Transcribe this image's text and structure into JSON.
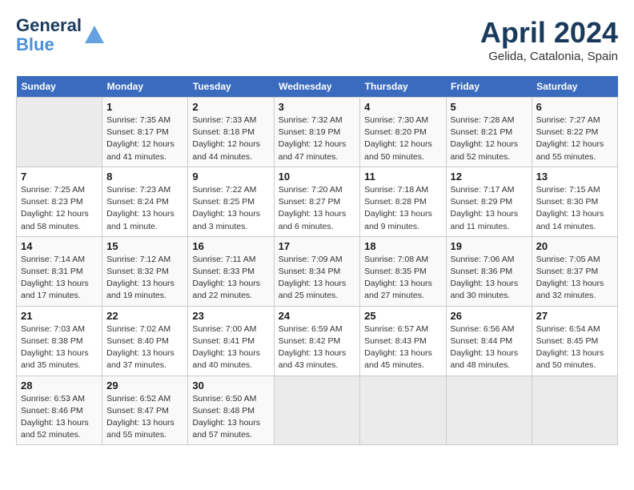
{
  "header": {
    "logo_line1": "General",
    "logo_line2": "Blue",
    "month_title": "April 2024",
    "subtitle": "Gelida, Catalonia, Spain"
  },
  "days_of_week": [
    "Sunday",
    "Monday",
    "Tuesday",
    "Wednesday",
    "Thursday",
    "Friday",
    "Saturday"
  ],
  "weeks": [
    [
      {
        "day": "",
        "info": ""
      },
      {
        "day": "1",
        "info": "Sunrise: 7:35 AM\nSunset: 8:17 PM\nDaylight: 12 hours\nand 41 minutes."
      },
      {
        "day": "2",
        "info": "Sunrise: 7:33 AM\nSunset: 8:18 PM\nDaylight: 12 hours\nand 44 minutes."
      },
      {
        "day": "3",
        "info": "Sunrise: 7:32 AM\nSunset: 8:19 PM\nDaylight: 12 hours\nand 47 minutes."
      },
      {
        "day": "4",
        "info": "Sunrise: 7:30 AM\nSunset: 8:20 PM\nDaylight: 12 hours\nand 50 minutes."
      },
      {
        "day": "5",
        "info": "Sunrise: 7:28 AM\nSunset: 8:21 PM\nDaylight: 12 hours\nand 52 minutes."
      },
      {
        "day": "6",
        "info": "Sunrise: 7:27 AM\nSunset: 8:22 PM\nDaylight: 12 hours\nand 55 minutes."
      }
    ],
    [
      {
        "day": "7",
        "info": "Sunrise: 7:25 AM\nSunset: 8:23 PM\nDaylight: 12 hours\nand 58 minutes."
      },
      {
        "day": "8",
        "info": "Sunrise: 7:23 AM\nSunset: 8:24 PM\nDaylight: 13 hours\nand 1 minute."
      },
      {
        "day": "9",
        "info": "Sunrise: 7:22 AM\nSunset: 8:25 PM\nDaylight: 13 hours\nand 3 minutes."
      },
      {
        "day": "10",
        "info": "Sunrise: 7:20 AM\nSunset: 8:27 PM\nDaylight: 13 hours\nand 6 minutes."
      },
      {
        "day": "11",
        "info": "Sunrise: 7:18 AM\nSunset: 8:28 PM\nDaylight: 13 hours\nand 9 minutes."
      },
      {
        "day": "12",
        "info": "Sunrise: 7:17 AM\nSunset: 8:29 PM\nDaylight: 13 hours\nand 11 minutes."
      },
      {
        "day": "13",
        "info": "Sunrise: 7:15 AM\nSunset: 8:30 PM\nDaylight: 13 hours\nand 14 minutes."
      }
    ],
    [
      {
        "day": "14",
        "info": "Sunrise: 7:14 AM\nSunset: 8:31 PM\nDaylight: 13 hours\nand 17 minutes."
      },
      {
        "day": "15",
        "info": "Sunrise: 7:12 AM\nSunset: 8:32 PM\nDaylight: 13 hours\nand 19 minutes."
      },
      {
        "day": "16",
        "info": "Sunrise: 7:11 AM\nSunset: 8:33 PM\nDaylight: 13 hours\nand 22 minutes."
      },
      {
        "day": "17",
        "info": "Sunrise: 7:09 AM\nSunset: 8:34 PM\nDaylight: 13 hours\nand 25 minutes."
      },
      {
        "day": "18",
        "info": "Sunrise: 7:08 AM\nSunset: 8:35 PM\nDaylight: 13 hours\nand 27 minutes."
      },
      {
        "day": "19",
        "info": "Sunrise: 7:06 AM\nSunset: 8:36 PM\nDaylight: 13 hours\nand 30 minutes."
      },
      {
        "day": "20",
        "info": "Sunrise: 7:05 AM\nSunset: 8:37 PM\nDaylight: 13 hours\nand 32 minutes."
      }
    ],
    [
      {
        "day": "21",
        "info": "Sunrise: 7:03 AM\nSunset: 8:38 PM\nDaylight: 13 hours\nand 35 minutes."
      },
      {
        "day": "22",
        "info": "Sunrise: 7:02 AM\nSunset: 8:40 PM\nDaylight: 13 hours\nand 37 minutes."
      },
      {
        "day": "23",
        "info": "Sunrise: 7:00 AM\nSunset: 8:41 PM\nDaylight: 13 hours\nand 40 minutes."
      },
      {
        "day": "24",
        "info": "Sunrise: 6:59 AM\nSunset: 8:42 PM\nDaylight: 13 hours\nand 43 minutes."
      },
      {
        "day": "25",
        "info": "Sunrise: 6:57 AM\nSunset: 8:43 PM\nDaylight: 13 hours\nand 45 minutes."
      },
      {
        "day": "26",
        "info": "Sunrise: 6:56 AM\nSunset: 8:44 PM\nDaylight: 13 hours\nand 48 minutes."
      },
      {
        "day": "27",
        "info": "Sunrise: 6:54 AM\nSunset: 8:45 PM\nDaylight: 13 hours\nand 50 minutes."
      }
    ],
    [
      {
        "day": "28",
        "info": "Sunrise: 6:53 AM\nSunset: 8:46 PM\nDaylight: 13 hours\nand 52 minutes."
      },
      {
        "day": "29",
        "info": "Sunrise: 6:52 AM\nSunset: 8:47 PM\nDaylight: 13 hours\nand 55 minutes."
      },
      {
        "day": "30",
        "info": "Sunrise: 6:50 AM\nSunset: 8:48 PM\nDaylight: 13 hours\nand 57 minutes."
      },
      {
        "day": "",
        "info": ""
      },
      {
        "day": "",
        "info": ""
      },
      {
        "day": "",
        "info": ""
      },
      {
        "day": "",
        "info": ""
      }
    ]
  ]
}
